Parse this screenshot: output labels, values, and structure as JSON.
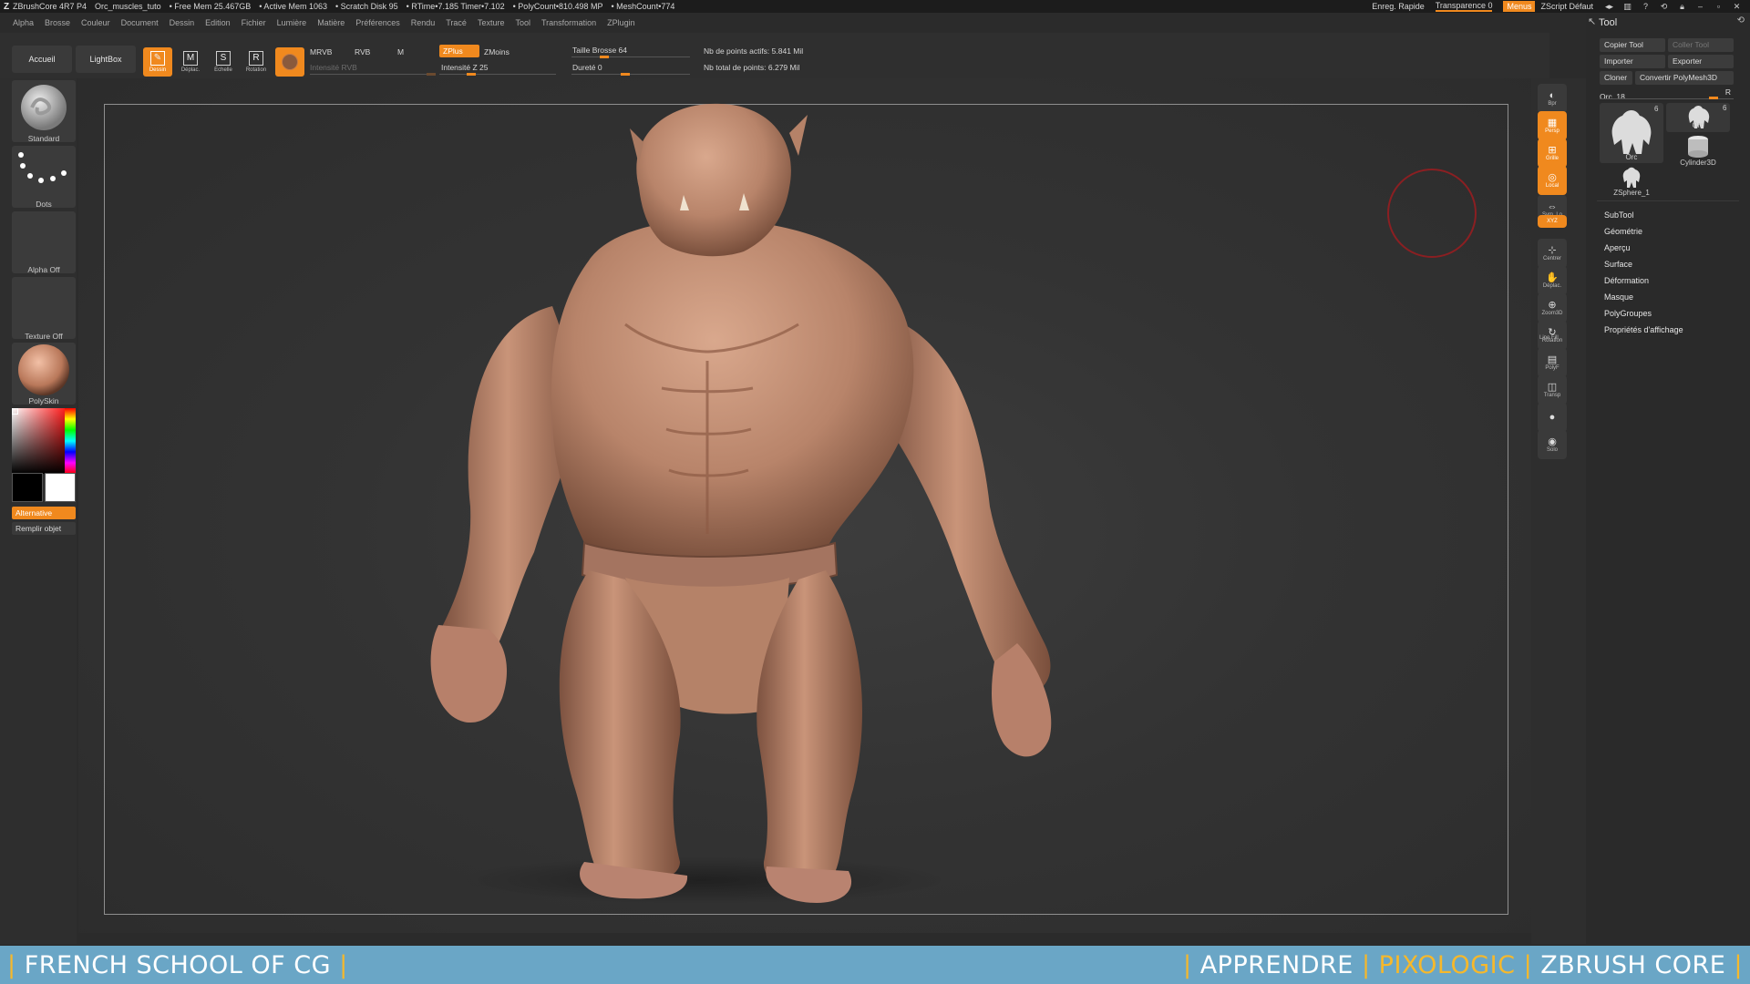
{
  "titlebar": {
    "app": "ZBrushCore 4R7 P4",
    "project": "Orc_muscles_tuto",
    "free_mem": "• Free Mem 25.467GB",
    "active_mem": "• Active Mem 1063",
    "scratch": "• Scratch Disk 95",
    "rtime": "• RTime•7.185 Timer•7.102",
    "polycount": "• PolyCount•810.498 MP",
    "meshcount": "• MeshCount•774",
    "quicksave": "Enreg. Rapide",
    "transparency": "Transparence 0",
    "menus": "Menus",
    "script": "ZScript Défaut"
  },
  "menubar": [
    "Alpha",
    "Brosse",
    "Couleur",
    "Document",
    "Dessin",
    "Edition",
    "Fichier",
    "Lumière",
    "Matière",
    "Préférences",
    "Rendu",
    "Tracé",
    "Texture",
    "Tool",
    "Transformation",
    "ZPlugin"
  ],
  "shelf": {
    "home": "Accueil",
    "lightbox": "LightBox",
    "draw": "Dessin",
    "move": "Déplac.",
    "scale": "Echelle",
    "rotate": "Rotation",
    "mrvb": "MRVB",
    "rvb": "RVB",
    "m": "M",
    "rgb_intensity": "Intensité RVB",
    "zadd": "ZPlus",
    "zsub": "ZMoins",
    "z_intensity": "Intensité Z 25",
    "brush_size": "Taille Brosse 64",
    "hardness": "Dureté 0",
    "active_points": "Nb de points actifs: 5.841 Mil",
    "total_points": "Nb total de points: 6.279 Mil",
    "z_intensity_value": 0.25,
    "brush_size_fraction": 0.26,
    "hardness_fraction": 0.45
  },
  "leftpanel": {
    "brush": "Standard",
    "stroke": "Dots",
    "alpha": "Alpha Off",
    "texture": "Texture Off",
    "material": "PolySkin",
    "alternate": "Alternative",
    "fill": "Remplir objet"
  },
  "rightstrip": [
    {
      "label": "Bpr",
      "glyph": "◐",
      "active": false
    },
    {
      "label": "Persp",
      "glyph": "▦",
      "active": true
    },
    {
      "label": "Grille",
      "glyph": "⊞",
      "active": true
    },
    {
      "label": "Local",
      "glyph": "◎",
      "active": true
    },
    {
      "label": "Sym. Lo",
      "glyph": "⇔",
      "active": false
    },
    {
      "label": "XYZ",
      "glyph": "",
      "active": true
    },
    {
      "label": "Centrer",
      "glyph": "⊹",
      "active": false
    },
    {
      "label": "Déplac.",
      "glyph": "✋",
      "active": false
    },
    {
      "label": "Zoom3D",
      "glyph": "⊕",
      "active": false
    },
    {
      "label": "Rotation",
      "glyph": "↻",
      "active": false
    },
    {
      "label": "PolyF",
      "glyph": "▤",
      "active": false
    },
    {
      "label": "Transp",
      "glyph": "◫",
      "active": false
    },
    {
      "label": "",
      "glyph": "●",
      "active": false
    },
    {
      "label": "Solo",
      "glyph": "◉",
      "active": false
    }
  ],
  "rightstrip_linefill": "Line Fill",
  "toolpanel": {
    "title": "Tool",
    "copy_tool": "Copier Tool",
    "paste_tool": "Coller Tool",
    "import": "Importer",
    "export": "Exporter",
    "clone": "Cloner",
    "convert": "Convertir PolyMesh3D",
    "current": "Orc. 18",
    "current_right": "R",
    "items": [
      {
        "name": "Orc",
        "count": "6"
      },
      {
        "name": "Orc",
        "count": "6"
      },
      {
        "name": "Cylinder3D",
        "count": ""
      },
      {
        "name": "ZSphere_1",
        "count": ""
      }
    ],
    "menus": [
      "SubTool",
      "Géométrie",
      "Aperçu",
      "Surface",
      "Déformation",
      "Masque",
      "PolyGroupes",
      "Propriétés d'affichage"
    ]
  },
  "banner": {
    "left": "FRENCH SCHOOL OF CG",
    "learn": "APPRENDRE",
    "brand": "PIXOLOGIC",
    "product": "ZBRUSH CORE",
    "sep": "|"
  },
  "colors": {
    "accent": "#f0891e",
    "banner_bg": "#6aa6c6",
    "banner_brand": "#f6b82b",
    "skin": "#c28f76",
    "cursor": "#8b1f22"
  }
}
